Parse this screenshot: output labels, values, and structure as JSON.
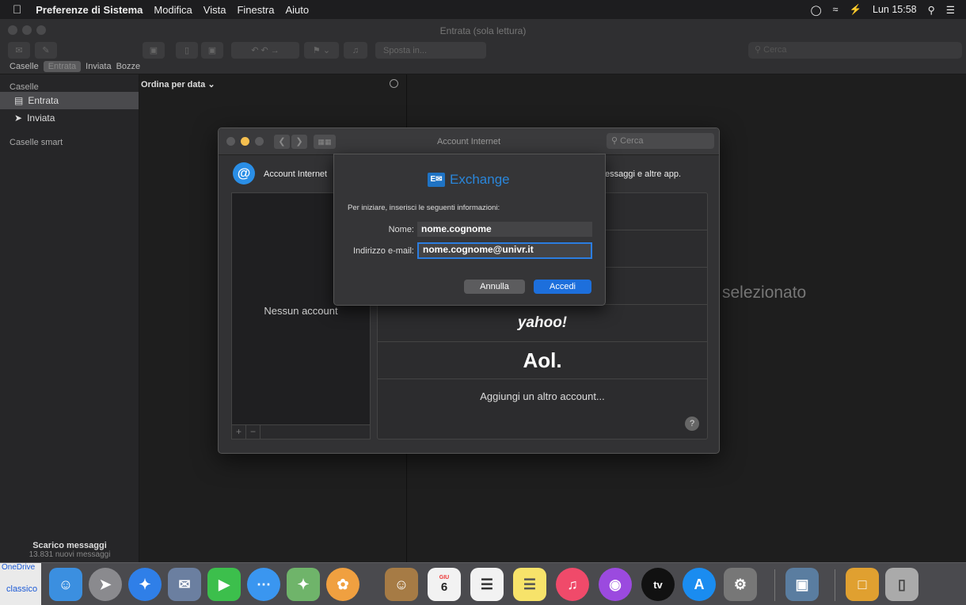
{
  "menubar": {
    "app": "Preferenze di Sistema",
    "items": [
      "Modifica",
      "Vista",
      "Finestra",
      "Aiuto"
    ],
    "clock": "Lun 15:58",
    "battery": "⚡"
  },
  "mail": {
    "window_title": "Entrata (sola lettura)",
    "move_label": "Sposta in...",
    "search_placeholder": "Cerca",
    "favorites": {
      "mailboxes": "Caselle",
      "inbox": "Entrata",
      "sent": "Inviata",
      "drafts": "Bozze"
    },
    "sidebar": {
      "header": "Caselle",
      "items": [
        "Entrata",
        "Inviata"
      ],
      "smart_header": "Caselle smart",
      "status_title": "Scarico messaggi",
      "status_sub": "13.831 nuovi messaggi"
    },
    "list": {
      "sort_label": "Ordina per data ⌄"
    },
    "viewer": {
      "message": "selezionato"
    }
  },
  "prefs": {
    "title": "Account Internet",
    "search_placeholder": "Cerca",
    "header_title": "Account Internet",
    "header_desc": "essaggi e altre app.",
    "empty_accounts": "Nessun account",
    "providers": {
      "yahoo": "yahoo!",
      "aol": "Aol.",
      "other": "Aggiungi un altro account..."
    },
    "help": "?"
  },
  "sheet": {
    "logo_text": "Exchange",
    "intro": "Per iniziare, inserisci le seguenti informazioni:",
    "name_label": "Nome:",
    "name_value": "nome.cognome",
    "email_label": "Indirizzo e-mail:",
    "email_value": "nome.cognome@univr.it",
    "cancel_label": "Annulla",
    "ok_label": "Accedi"
  },
  "dock": {
    "onedrive": "OneDrive",
    "classico": "classico",
    "calendar_month": "GIU",
    "calendar_day": "6"
  },
  "colors": {
    "accent": "#1d6fdc",
    "exchange": "#2a86da"
  }
}
